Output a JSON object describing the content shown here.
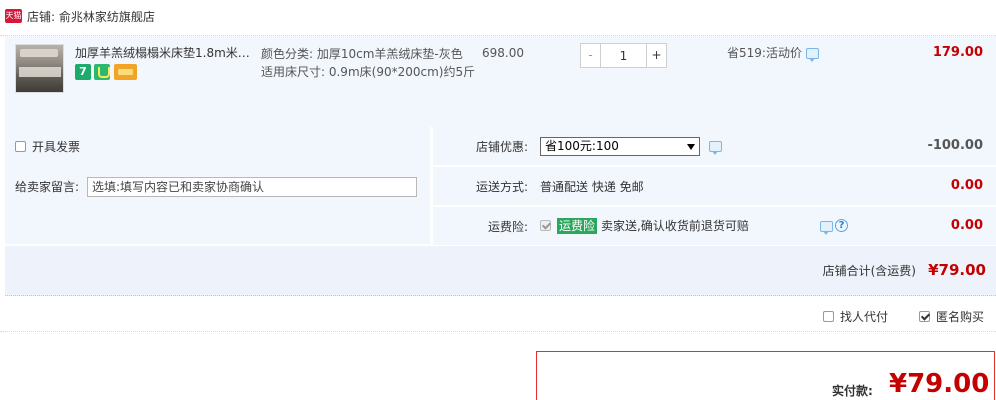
{
  "shop": {
    "badge": "天猫",
    "name": "店铺: 俞兆林家纺旗舰店"
  },
  "item": {
    "title": "加厚羊羔绒榻榻米床垫1.8m米1...",
    "service_icons": [
      "seven-day-return-icon",
      "shield-icon",
      "card-icon"
    ],
    "seven_day_text": "7",
    "sku_lines": [
      "颜色分类: 加厚10cm羊羔绒床垫-灰色",
      "适用床尺寸: 0.9m床(90*200cm)约5斤"
    ],
    "unit_price": "698.00",
    "quantity": {
      "minus_label": "-",
      "value": "1",
      "plus_label": "+"
    },
    "promotion": "省519:活动价",
    "total": "179.00"
  },
  "options": {
    "invoice_label": "开具发票",
    "invoice_checked": false,
    "memo_label": "给卖家留言:",
    "memo_placeholder": "选填:填写内容已和卖家协商确认",
    "coupon": {
      "label": "店铺优惠:",
      "selected": "省100元:100",
      "amount": "-100.00"
    },
    "shipping": {
      "label": "运送方式:",
      "value": "普通配送 快递 免邮",
      "amount": "0.00"
    },
    "insurance": {
      "label": "运费险:",
      "badge": "运费险",
      "desc": "卖家送,确认收货前退货可赔",
      "amount": "0.00",
      "help_symbol": "?"
    }
  },
  "store_total": {
    "label": "店铺合计(含运费)",
    "amount": "¥79.00"
  },
  "checkout": {
    "proxy_label": "找人代付",
    "proxy_checked": false,
    "anon_label": "匿名购买",
    "anon_checked": true
  },
  "payment": {
    "label": "实付款:",
    "amount": "¥79.00"
  },
  "colors": {
    "accent_red": "#c40000",
    "row_bg": "#f2f6fd",
    "tmall_red": "#d9163a",
    "insurance_green": "#2aa75c"
  }
}
